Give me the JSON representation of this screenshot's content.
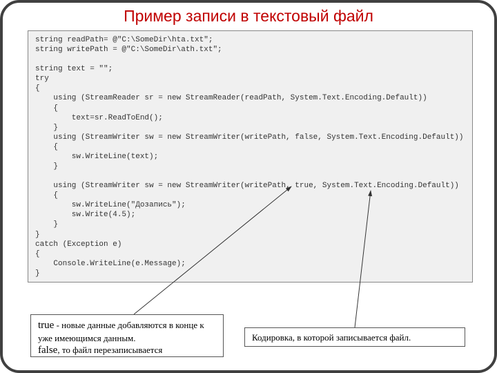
{
  "title": "Пример записи в текстовый файл",
  "code": "string readPath= @\"C:\\SomeDir\\hta.txt\";\nstring writePath = @\"C:\\SomeDir\\ath.txt\";\n\nstring text = \"\";\ntry\n{\n    using (StreamReader sr = new StreamReader(readPath, System.Text.Encoding.Default))\n    {\n        text=sr.ReadToEnd();\n    }\n    using (StreamWriter sw = new StreamWriter(writePath, false, System.Text.Encoding.Default))\n    {\n        sw.WriteLine(text);\n    }\n\n    using (StreamWriter sw = new StreamWriter(writePath, true, System.Text.Encoding.Default))\n    {\n        sw.WriteLine(\"Дозапись\");\n        sw.Write(4.5);\n    }\n}\ncatch (Exception e)\n{\n    Console.WriteLine(e.Message);\n}",
  "note_true_prefix": "true",
  "note_true_text": " - новые данные добавляются в конце к уже имеющимся данным.",
  "note_false_prefix": "false",
  "note_false_text": ", то файл перезаписывается",
  "note_encoding": "Кодировка, в которой записывается файл."
}
